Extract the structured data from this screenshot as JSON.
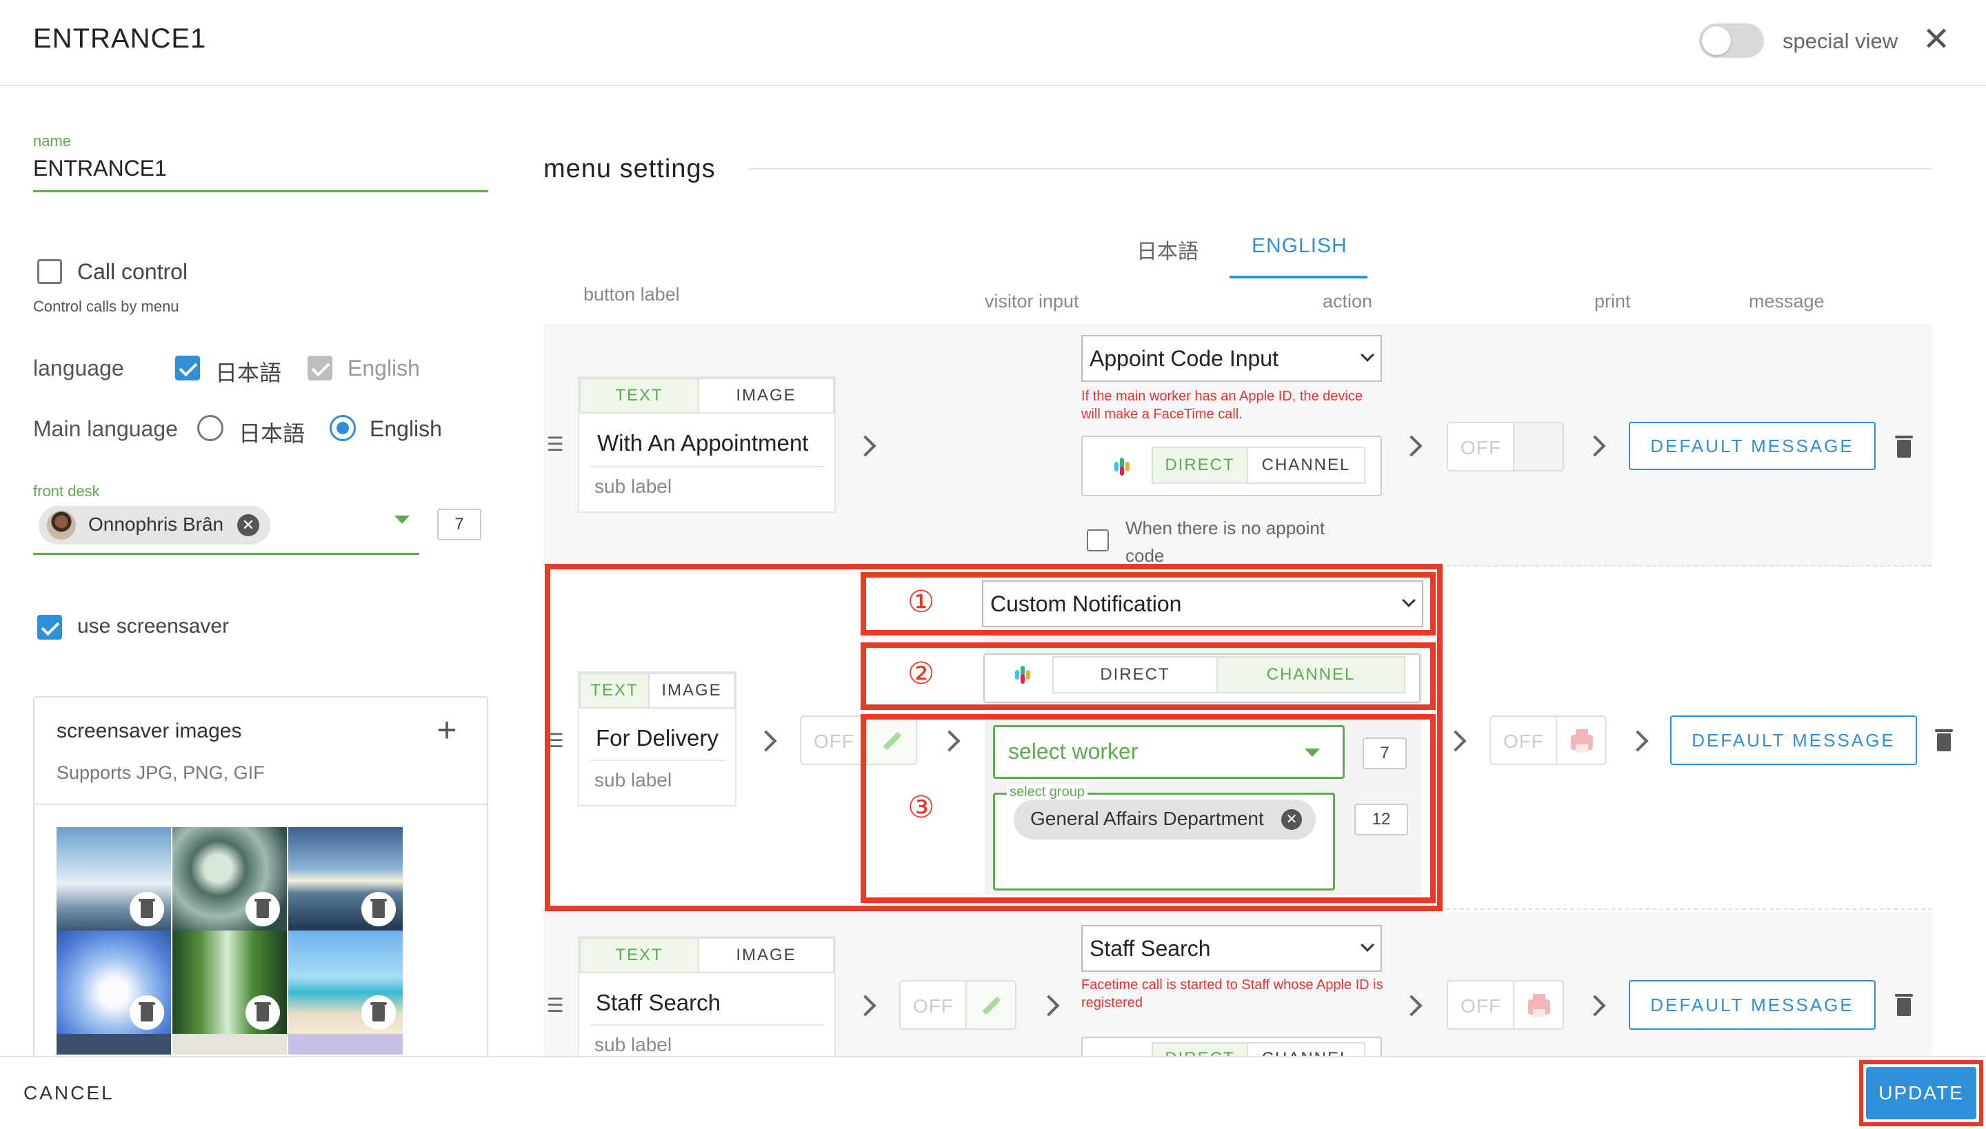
{
  "header": {
    "title": "ENTRANCE1",
    "special_view_label": "special view",
    "close_icon": "close-icon"
  },
  "left": {
    "name_label": "name",
    "name_value": "ENTRANCE1",
    "call_control_label": "Call control",
    "call_control_desc": "Control calls by menu",
    "language_label": "language",
    "language_ja": "日本語",
    "language_en": "English",
    "main_language_label": "Main language",
    "main_language_ja": "日本語",
    "main_language_en": "English",
    "front_desk_label": "front desk",
    "front_desk_person": "Onnophris Brân",
    "front_desk_count": "7",
    "use_screensaver_label": "use screensaver",
    "screensaver_title": "screensaver images",
    "screensaver_supports": "Supports JPG, PNG, GIF"
  },
  "menu": {
    "title": "menu settings",
    "tabs": [
      "日本語",
      "ENGLISH"
    ],
    "columns": {
      "button_label": "button label",
      "visitor_input": "visitor input",
      "action": "action",
      "print": "print",
      "message": "message"
    },
    "seg_text": "TEXT",
    "seg_image": "IMAGE",
    "sub_label": "sub label",
    "off_label": "OFF",
    "direct": "DIRECT",
    "channel": "CHANNEL",
    "default_message": "DEFAULT MESSAGE",
    "rows": [
      {
        "label": "With An Appointment",
        "action": "Appoint Code Input",
        "hint": "If the main worker has an Apple ID, the device will make a FaceTime call.",
        "no_code_label": "When there is no appoint code"
      },
      {
        "label": "For Delivery",
        "action": "Custom Notification",
        "select_worker": "select worker",
        "worker_count": "7",
        "select_group_label": "select group",
        "group": "General Affairs Department",
        "group_count": "12",
        "markers": [
          "①",
          "②",
          "③"
        ]
      },
      {
        "label": "Staff Search",
        "action": "Staff Search",
        "hint": "Facetime call is started to Staff whose Apple ID is registered"
      }
    ]
  },
  "footer": {
    "cancel": "CANCEL",
    "update": "UPDATE"
  },
  "colors": {
    "accent_blue": "#2f8fd8",
    "accent_green": "#5cab4f",
    "annotation_red": "#e63b24",
    "hint_red": "#e3342f"
  }
}
